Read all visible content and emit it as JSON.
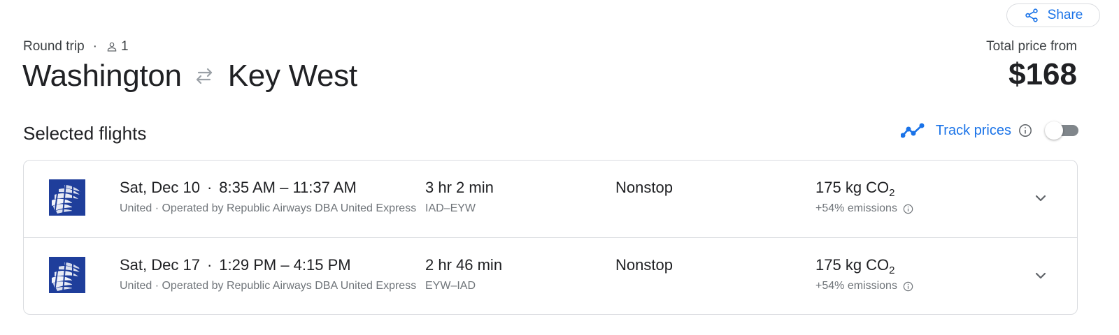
{
  "share": {
    "label": "Share",
    "icon": "share-icon"
  },
  "trip": {
    "type": "Round trip",
    "separator": "·",
    "passengers": "1",
    "passenger_icon": "person-icon",
    "origin": "Washington",
    "destination": "Key West",
    "swap_icon": "round-trip-arrows-icon"
  },
  "price": {
    "label": "Total price from",
    "value": "$168"
  },
  "section": {
    "title": "Selected flights",
    "track_label": "Track prices",
    "track_enabled": false
  },
  "colors": {
    "accent": "#1a73e8",
    "united_blue": "#1f3e9b",
    "text_primary": "#202124",
    "text_secondary": "#70757a",
    "border": "#dadce0"
  },
  "flights": [
    {
      "airline_logo": "united-globe-logo",
      "date": "Sat, Dec 10",
      "separator": "·",
      "times": "8:35 AM – 11:37 AM",
      "airline": "United · Operated by Republic Airways DBA United Express",
      "duration": "3 hr 2 min",
      "airports": "IAD–EYW",
      "stops": "Nonstop",
      "co2_value": "175 kg CO",
      "co2_sub": "2",
      "emissions": "+54% emissions"
    },
    {
      "airline_logo": "united-globe-logo",
      "date": "Sat, Dec 17",
      "separator": "·",
      "times": "1:29 PM – 4:15 PM",
      "airline": "United · Operated by Republic Airways DBA United Express",
      "duration": "2 hr 46 min",
      "airports": "EYW–IAD",
      "stops": "Nonstop",
      "co2_value": "175 kg CO",
      "co2_sub": "2",
      "emissions": "+54% emissions"
    }
  ]
}
